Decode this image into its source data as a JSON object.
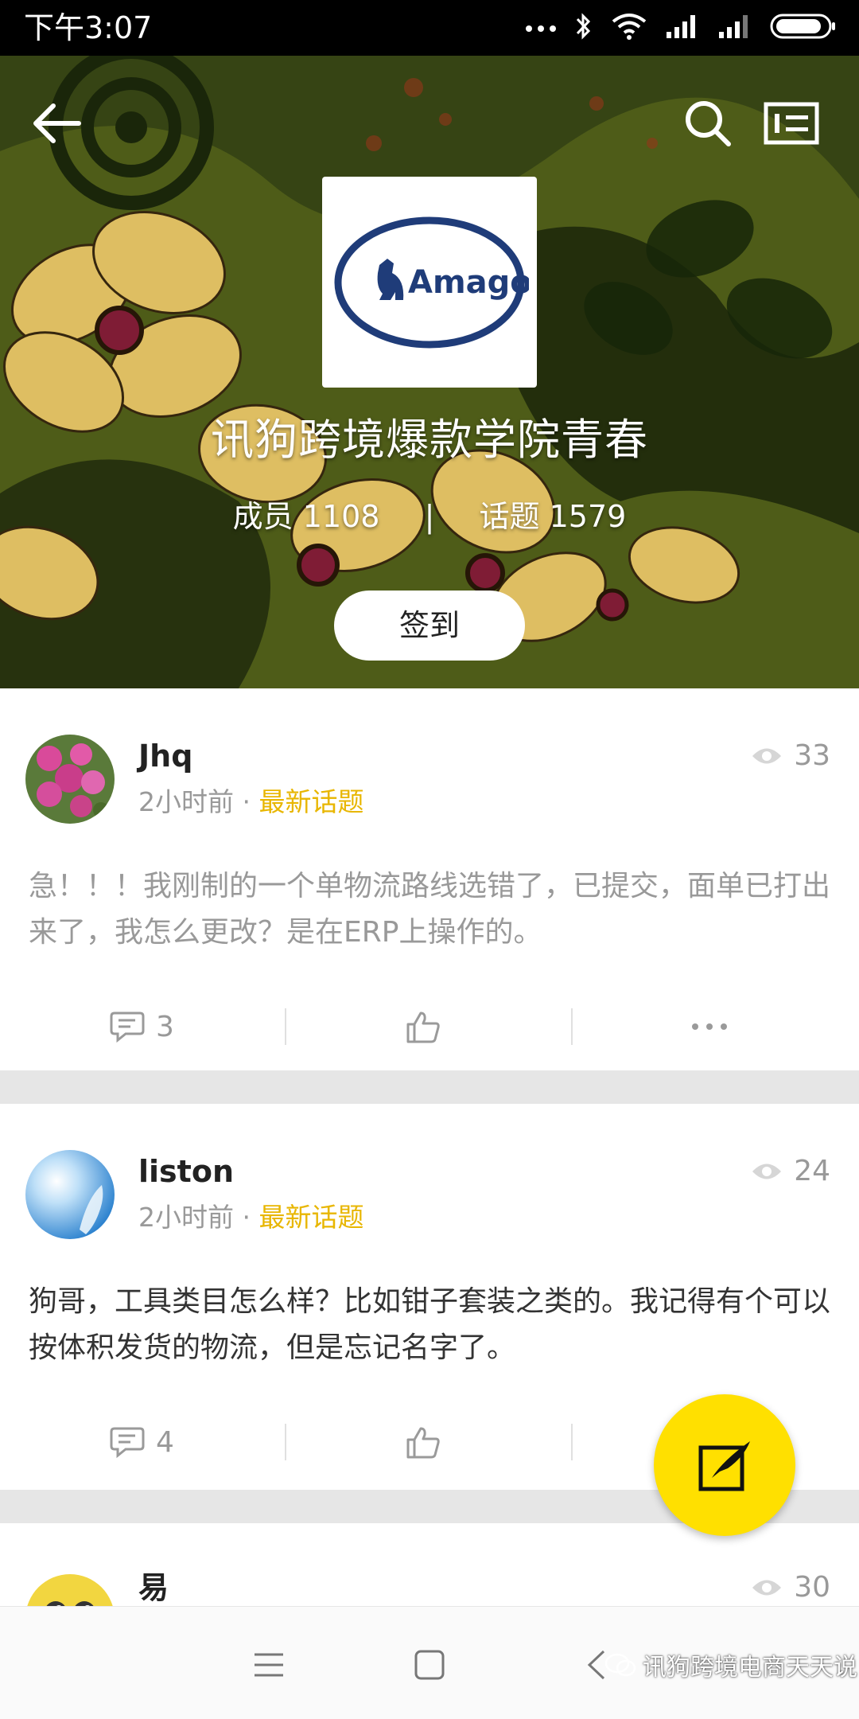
{
  "status_bar": {
    "time": "下午3:07"
  },
  "group": {
    "logo_text": "Amago",
    "title": "讯狗跨境爆款学院青春",
    "members_label": "成员",
    "members_count": "1108",
    "separator": "|",
    "topics_label": "话题",
    "topics_count": "1579",
    "checkin_label": "签到"
  },
  "posts": [
    {
      "author": "Jhq",
      "time": "2小时前",
      "dot": "·",
      "topic": "最新话题",
      "views": "33",
      "content": "急！！！我刚制的一个单物流路线选错了，已提交，面单已打出来了，我怎么更改？是在ERP上操作的。",
      "comments": "3",
      "content_color": "#999999"
    },
    {
      "author": "liston",
      "time": "2小时前",
      "dot": "·",
      "topic": "最新话题",
      "views": "24",
      "content": "狗哥，工具类目怎么样？比如钳子套装之类的。我记得有个可以按体积发货的物流，但是忘记名字了。",
      "comments": "4",
      "content_color": "#333333"
    },
    {
      "author": "易",
      "views": "30"
    }
  ],
  "watermark": {
    "text": "讯狗跨境电商天天说"
  },
  "colors": {
    "accent": "#ffe000",
    "topic": "#e8b600",
    "muted": "#999999"
  },
  "icons": {
    "back": "arrow-left-icon",
    "search": "search-icon",
    "info": "info-card-icon",
    "views": "eye-icon",
    "comment": "comment-icon",
    "like": "thumbs-up-icon",
    "more": "more-icon",
    "compose": "compose-icon"
  }
}
